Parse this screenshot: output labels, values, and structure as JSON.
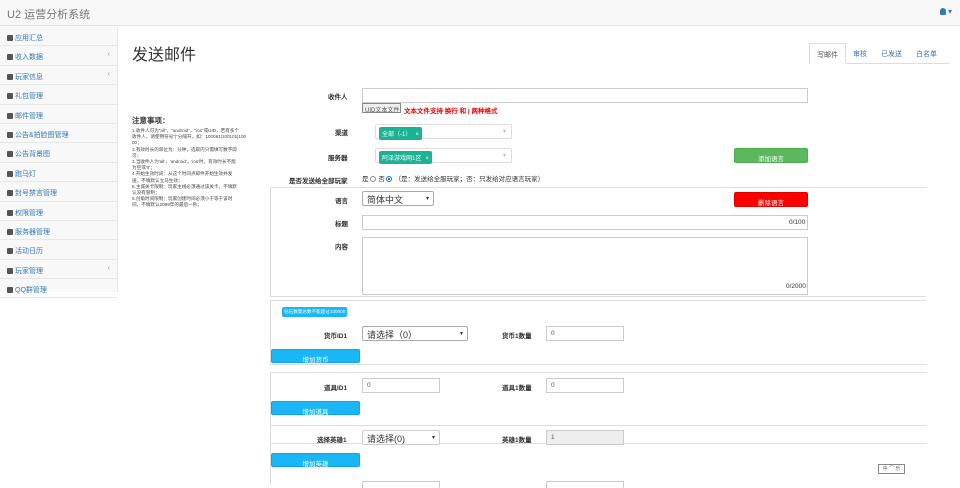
{
  "app": {
    "title": "U2 运营分析系统",
    "user_caret": "▾"
  },
  "sidebar": {
    "items": [
      {
        "label": "应用汇总",
        "has_sub": false,
        "icon": "dashboard-icon"
      },
      {
        "label": "收入数据",
        "has_sub": true,
        "icon": "money-icon"
      },
      {
        "label": "玩家信息",
        "has_sub": true,
        "icon": "id-card-icon"
      },
      {
        "label": "礼包管理",
        "has_sub": false,
        "icon": "list-icon"
      },
      {
        "label": "邮件管理",
        "has_sub": false,
        "icon": "list-icon"
      },
      {
        "label": "公告&拍脸图管理",
        "has_sub": false,
        "icon": "list-icon"
      },
      {
        "label": "公告背景图",
        "has_sub": false,
        "icon": "list-icon"
      },
      {
        "label": "跑马灯",
        "has_sub": false,
        "icon": "list-icon"
      },
      {
        "label": "封号禁言管理",
        "has_sub": false,
        "icon": "ban-icon"
      },
      {
        "label": "权限管理",
        "has_sub": false,
        "icon": "wrench-icon"
      },
      {
        "label": "服务器管理",
        "has_sub": false,
        "icon": "server-icon"
      },
      {
        "label": "活动日历",
        "has_sub": false,
        "icon": "calendar-icon"
      },
      {
        "label": "玩家管理",
        "has_sub": true,
        "icon": "user-icon"
      },
      {
        "label": "QQ群管理",
        "has_sub": false,
        "icon": "qq-icon"
      }
    ],
    "chevron": "‹"
  },
  "page": {
    "title": "发送邮件",
    "tabs": [
      "写邮件",
      "审核",
      "已发送",
      "白名单"
    ]
  },
  "notes": {
    "title": "注意事项：",
    "lines": [
      "1.收件人可为\"all\"，\"android\"，\"ios\"或UID，若有多个",
      "收件人，请使用符号\"|\"分隔开。如：100081|100101|100",
      "00；",
      "2.有效时长的单位为：分钟，选取内只需填写数字即",
      "可；",
      "3.当收件人为'all'，'android'，'ios'时，有效时长不能",
      "为空或'0'；",
      "4.开始生效时间：从这个时间点邮件开始生效并发",
      "送，不填默认立马生效；",
      "5.主城关卡限制：玩家主线必须通过该关卡，不填默",
      "认没有限制；",
      "6.创角时间限制：玩家创建时间必须小于等于该时",
      "间，不填默认2099年的最后一秒。"
    ]
  },
  "form": {
    "recipient_label": "收件人",
    "recipient_value": "",
    "uid_file_button": "UID文本文件",
    "uid_file_hint": "文本文件支持 换行 和 | 两种格式",
    "channel_label": "渠道",
    "channel_tag": "全部（-1）",
    "server_label": "服务器",
    "server_tag": "阿泽游戏网1区",
    "add_language_button": "添加语言",
    "send_all_label": "是否发送给全部玩家",
    "send_all_yes": "是",
    "send_all_no": "否",
    "send_all_hint": "（是：发送给全服玩家；否：只发给对应语言玩家）",
    "language_label": "语言",
    "language_value": "简体中文",
    "delete_language_button": "删除语言",
    "title_label": "标题",
    "title_counter": "0/100",
    "content_label": "内容",
    "content_counter": "0/2000",
    "diamond_badge": "钻石数量总数不能超过100000",
    "currency_label": "货币ID1",
    "currency_select": "请选择（0）",
    "currency_qty_label": "货币1数量",
    "currency_qty_value": "0",
    "add_currency_button": "增加货币",
    "item_label": "道具ID1",
    "item_value": "0",
    "item_qty_label": "道具1数量",
    "item_qty_value": "0",
    "add_item_button": "增加道具",
    "hero_label": "选择英雄1",
    "hero_select": "请选择(0)",
    "hero_qty_label": "英雄1数量",
    "hero_qty_value": "1",
    "add_hero_button": "增加英雄"
  },
  "stamp": "中 ⌒ 乐"
}
